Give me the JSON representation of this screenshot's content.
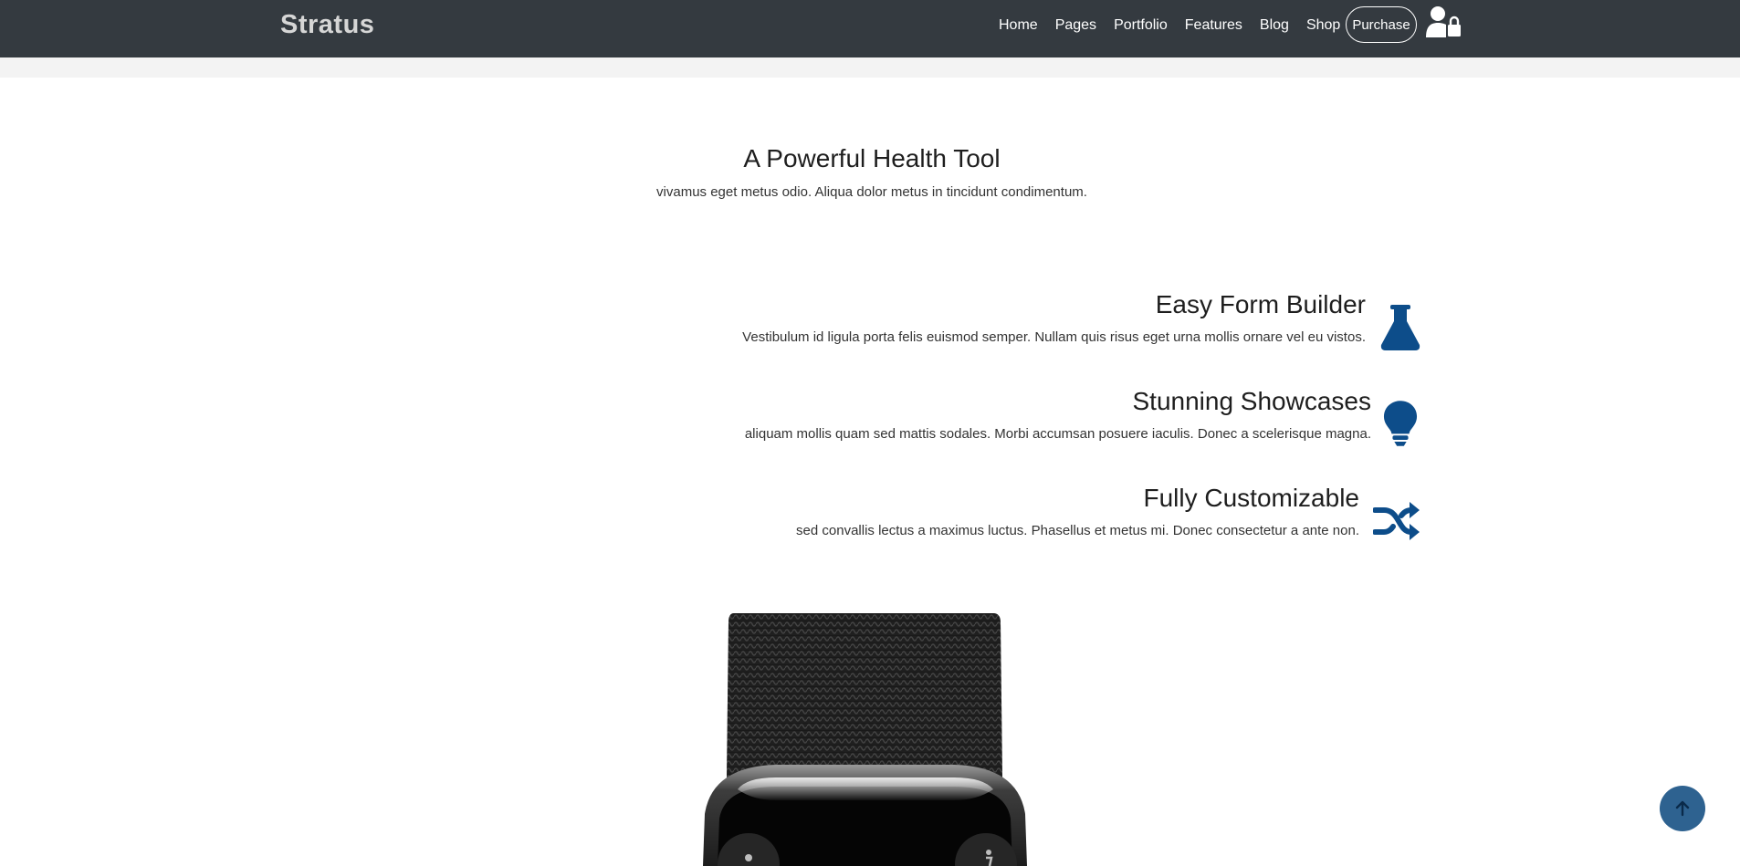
{
  "brand": "Stratus",
  "nav": {
    "links": [
      "Home",
      "Pages",
      "Portfolio",
      "Features",
      "Blog",
      "Shop"
    ],
    "purchase_label": "Purchase",
    "user_icon": "user-lock-icon"
  },
  "section": {
    "title": "A Powerful Health Tool",
    "subtitle": "vivamus eget metus odio. Aliqua dolor metus in tincidunt condimentum."
  },
  "features": [
    {
      "title": "Easy Form Builder",
      "description": "Vestibulum id ligula porta felis euismod semper. Nullam quis risus eget urna mollis ornare vel eu vistos.",
      "icon": "flask-icon"
    },
    {
      "title": "Stunning Showcases",
      "description": "aliquam mollis quam sed mattis sodales. Morbi accumsan posuere iaculis. Donec a scelerisque magna.",
      "icon": "lightbulb-icon"
    },
    {
      "title": "Fully Customizable",
      "description": "sed convallis lectus a maximus luctus. Phasellus et metus mi. Donec consectetur a ante non.",
      "icon": "shuffle-icon"
    }
  ],
  "colors": {
    "navbar": "#343a40",
    "accent": "#0d4d8a",
    "back_to_top": "#2e6290"
  },
  "back_to_top_icon": "arrow-up-icon"
}
